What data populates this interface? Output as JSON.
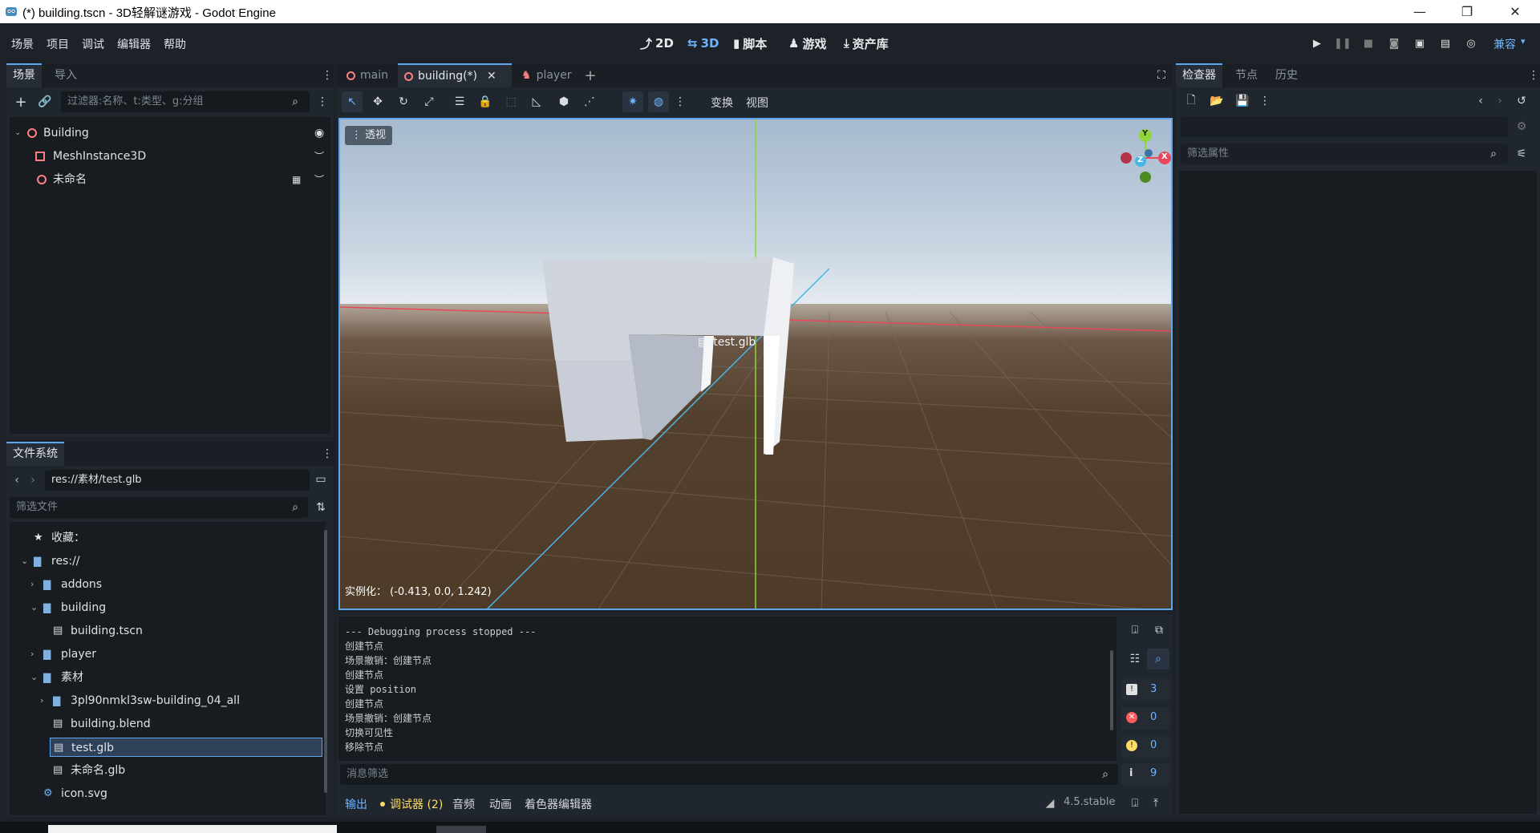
{
  "window": {
    "title": "(*) building.tscn - 3D轻解谜游戏 - Godot Engine",
    "minimize": "—",
    "maximize": "❐",
    "close": "✕"
  },
  "menu": [
    "场景",
    "项目",
    "调试",
    "编辑器",
    "帮助"
  ],
  "workspaces": [
    {
      "label": "2D",
      "icon": "2d-icon"
    },
    {
      "label": "3D",
      "icon": "3d-icon",
      "active": true
    },
    {
      "label": "脚本",
      "icon": "script-icon"
    },
    {
      "label": "游戏",
      "icon": "game-icon"
    },
    {
      "label": "资产库",
      "icon": "assetlib-icon"
    }
  ],
  "renderer": "兼容",
  "scene_dock": {
    "tabs": [
      "场景",
      "导入"
    ],
    "filter_placeholder": "过滤器:名称、t:类型、g:分组",
    "nodes": [
      {
        "name": "Building",
        "depth": 0,
        "icon": "node3d-icon"
      },
      {
        "name": "MeshInstance3D",
        "depth": 1,
        "icon": "mesh-icon"
      },
      {
        "name": "未命名",
        "depth": 1,
        "icon": "node3d-icon"
      }
    ]
  },
  "filesystem": {
    "title": "文件系统",
    "path": "res://素材/test.glb",
    "filter_placeholder": "筛选文件",
    "items": [
      {
        "name": "收藏：",
        "depth": 0,
        "icon": "star-icon"
      },
      {
        "name": "res://",
        "depth": 0,
        "icon": "folder-icon",
        "expanded": true
      },
      {
        "name": "addons",
        "depth": 1,
        "icon": "folder-icon",
        "collapsed": true
      },
      {
        "name": "building",
        "depth": 1,
        "icon": "folder-icon",
        "expanded": true
      },
      {
        "name": "building.tscn",
        "depth": 2,
        "icon": "scene-file-icon"
      },
      {
        "name": "player",
        "depth": 1,
        "icon": "folder-icon",
        "collapsed": true
      },
      {
        "name": "素材",
        "depth": 1,
        "icon": "folder-icon",
        "expanded": true
      },
      {
        "name": "3pl90nmkl3sw-building_04_all",
        "depth": 2,
        "icon": "folder-icon",
        "collapsed": true
      },
      {
        "name": "building.blend",
        "depth": 2,
        "icon": "scene-file-icon"
      },
      {
        "name": "test.glb",
        "depth": 2,
        "icon": "scene-file-icon",
        "selected": true
      },
      {
        "name": "未命名.glb",
        "depth": 2,
        "icon": "scene-file-icon"
      },
      {
        "name": "icon.svg",
        "depth": 1,
        "icon": "svg-file-icon"
      }
    ]
  },
  "editor_tabs": [
    {
      "label": "main"
    },
    {
      "label": "building(*)",
      "active": true
    },
    {
      "label": "player"
    }
  ],
  "toolbar": {
    "transform": "变换",
    "view": "视图"
  },
  "viewport": {
    "perspective_label": "透视",
    "instance_info": "实例化： (-0.413, 0.0, 1.242)",
    "drag_label": "test.glb",
    "gizmo": {
      "y": "Y",
      "x": "X",
      "z": "Z"
    }
  },
  "output": {
    "lines": [
      "--- Debugging process stopped ---",
      "创建节点",
      "场景撤销：创建节点",
      "创建节点",
      "设置 position",
      "创建节点",
      "场景撤销：创建节点",
      "切换可见性",
      "移除节点"
    ],
    "filter_placeholder": "消息筛选",
    "counts": {
      "messages": "3",
      "errors": "0",
      "warnings": "0",
      "info": "9"
    }
  },
  "bottom_tabs": {
    "output": "输出",
    "debugger": "调试器 (2)",
    "audio": "音频",
    "animation": "动画",
    "shader": "着色器编辑器",
    "version": "4.5.stable"
  },
  "inspector": {
    "tabs": [
      "检查器",
      "节点",
      "历史"
    ],
    "filter_placeholder": "筛选属性"
  },
  "colors": {
    "accent": "#5fa6f0",
    "x_axis": "#e8485a",
    "y_axis": "#8fd43a",
    "z_axis": "#45b6e6"
  }
}
